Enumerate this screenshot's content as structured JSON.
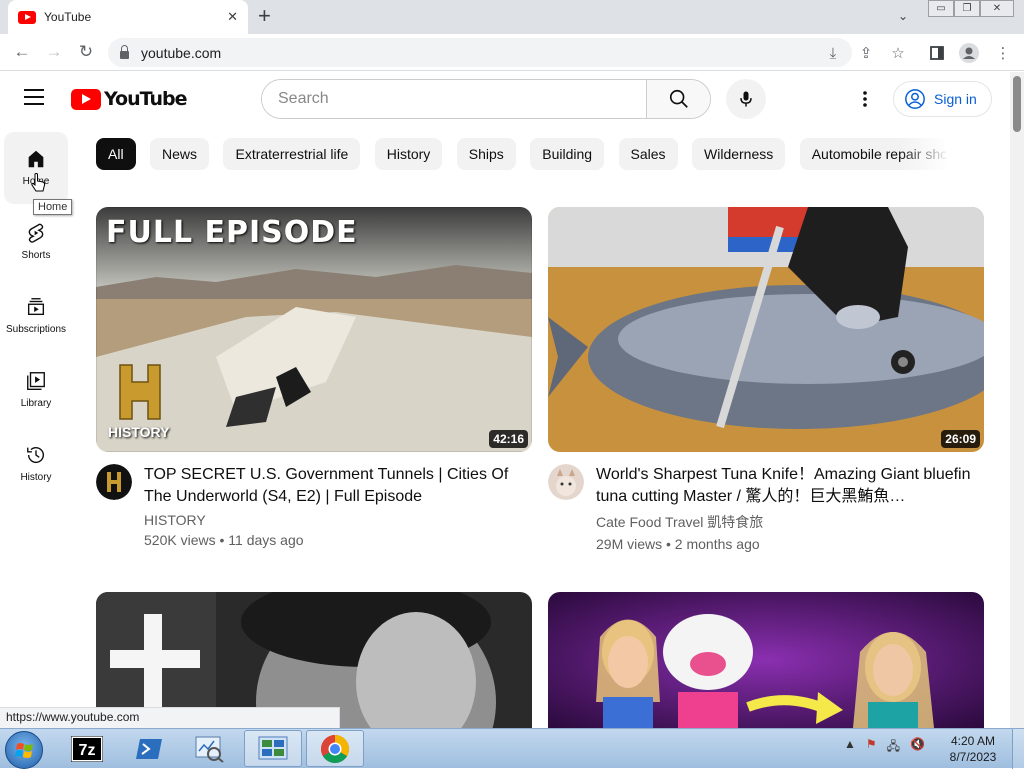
{
  "browser": {
    "tab_title": "YouTube",
    "address": "youtube.com",
    "status_url": "https://www.youtube.com"
  },
  "header": {
    "logo_text": "YouTube",
    "search_placeholder": "Search",
    "signin_label": "Sign in"
  },
  "sidebar": {
    "items": [
      {
        "label": "Home"
      },
      {
        "label": "Shorts"
      },
      {
        "label": "Subscriptions"
      },
      {
        "label": "Library"
      },
      {
        "label": "History"
      }
    ],
    "tooltip": "Home"
  },
  "chips": [
    "All",
    "News",
    "Extraterrestrial life",
    "History",
    "Ships",
    "Building",
    "Sales",
    "Wilderness",
    "Automobile repair shop"
  ],
  "videos": [
    {
      "thumb_overlay": "FULL EPISODE",
      "thumb_brand": "HISTORY",
      "duration": "42:16",
      "title": "TOP SECRET U.S. Government Tunnels | Cities Of The Underworld (S4, E2) | Full Episode",
      "channel": "HISTORY",
      "stats": "520K views • 11 days ago"
    },
    {
      "duration": "26:09",
      "title": "World's Sharpest Tuna Knife！Amazing Giant bluefin tuna cutting Master / 驚人的！巨大黑鮪魚…",
      "channel": "Cate Food Travel 凱特食旅",
      "stats": "29M views • 2 months ago"
    }
  ],
  "taskbar": {
    "time": "4:20 AM",
    "date": "8/7/2023",
    "apps": [
      "7z",
      "powershell",
      "task-manager",
      "control-panel",
      "chrome"
    ]
  },
  "colors": {
    "brand_red": "#ff0000",
    "link_blue": "#065fd4",
    "chip_active": "#0f0f0f"
  }
}
